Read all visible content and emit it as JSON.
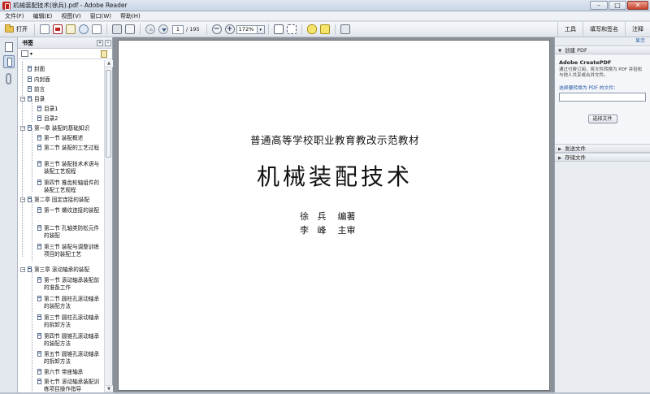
{
  "window": {
    "title": "机械装配技术(徐兵).pdf - Adobe Reader",
    "buttons": {
      "minimize": "–",
      "maximize": "□",
      "close": "✕"
    }
  },
  "menu": [
    "文件(F)",
    "编辑(E)",
    "视图(V)",
    "窗口(W)",
    "帮助(H)"
  ],
  "toolbar": {
    "open_label": "打开",
    "page_current": "1",
    "page_total": "/ 195",
    "zoom": "172%",
    "zoom_drop": "▾",
    "right": [
      "工具",
      "填写和签名",
      "注释"
    ],
    "icons": [
      "folder-icon",
      "document-icon",
      "create-pdf-icon",
      "edit-icon",
      "cloud-icon",
      "print-icon",
      "email-icon",
      "previous-page-icon",
      "next-page-icon",
      "zoom-out-icon",
      "zoom-in-icon",
      "fit-page-icon",
      "fit-width-icon",
      "comment-icon",
      "sign-icon",
      "tool-icon"
    ]
  },
  "bookmarks_panel": {
    "label": "书签",
    "collapse": "«",
    "options_drop": "▾",
    "items": [
      {
        "label": "封面",
        "level": 1
      },
      {
        "label": "内封面",
        "level": 1
      },
      {
        "label": "前言",
        "level": 1
      },
      {
        "label": "目录",
        "level": 1,
        "toggle": "−"
      },
      {
        "label": "目录1",
        "level": 2
      },
      {
        "label": "目录2",
        "level": 2
      },
      {
        "label": "第一章 装配的基础知识",
        "level": 1,
        "toggle": "−"
      },
      {
        "label": "第一节 装配概述",
        "level": 2
      },
      {
        "label": "第二节 装配的工艺过程",
        "level": 2
      },
      {
        "label": "第三节 装配技术术语与装配工艺规程",
        "level": 2
      },
      {
        "label": "第四节 推齿轮轴组件的装配工艺规程",
        "level": 2
      },
      {
        "label": "第二章 固定连接的装配",
        "level": 1,
        "toggle": "−"
      },
      {
        "label": "第一节 螺纹连接的装配",
        "level": 2
      },
      {
        "label": "第二节 孔轴类防松元件的装配",
        "level": 2
      },
      {
        "label": "第三节 装配与调整训练项目的装配工艺",
        "level": 2
      },
      {
        "label": "第三章 滚动轴承的装配",
        "level": 1,
        "toggle": "−"
      },
      {
        "label": "第一节 滚动轴承装配前的准备工作",
        "level": 2
      },
      {
        "label": "第二节 圆柱孔滚动轴承的装配方法",
        "level": 2
      },
      {
        "label": "第三节 圆柱孔滚动轴承的拆卸方法",
        "level": 2
      },
      {
        "label": "第四节 圆锥孔滚动轴承的装配方法",
        "level": 2
      },
      {
        "label": "第五节 圆锥孔滚动轴承的拆卸方法",
        "level": 2
      },
      {
        "label": "第六节 带座轴承",
        "level": 2
      },
      {
        "label": "第七节 滚动轴承装配训练项目操作指导",
        "level": 2
      }
    ]
  },
  "document": {
    "subtitle": "普通高等学校职业教育教改示范教材",
    "title": "机械装配技术",
    "author_line": "徐   兵    编著",
    "reviewer_line": "李   峰    主审"
  },
  "right_pane": {
    "show_link": "显示",
    "create_pdf": {
      "header": "创建 PDF",
      "toggle": "▼"
    },
    "service": "Adobe CreatePDF",
    "description": "通过付费订阅，将文件转换为 PDF 并轻松与他人共享或合并文件。",
    "select_label": "选择要转换为 PDF 的文件：",
    "select_button": "选择文件",
    "send_files": {
      "label": "发送文件",
      "toggle": "▶"
    },
    "store_files": {
      "label": "存储文件",
      "toggle": "▶"
    }
  }
}
